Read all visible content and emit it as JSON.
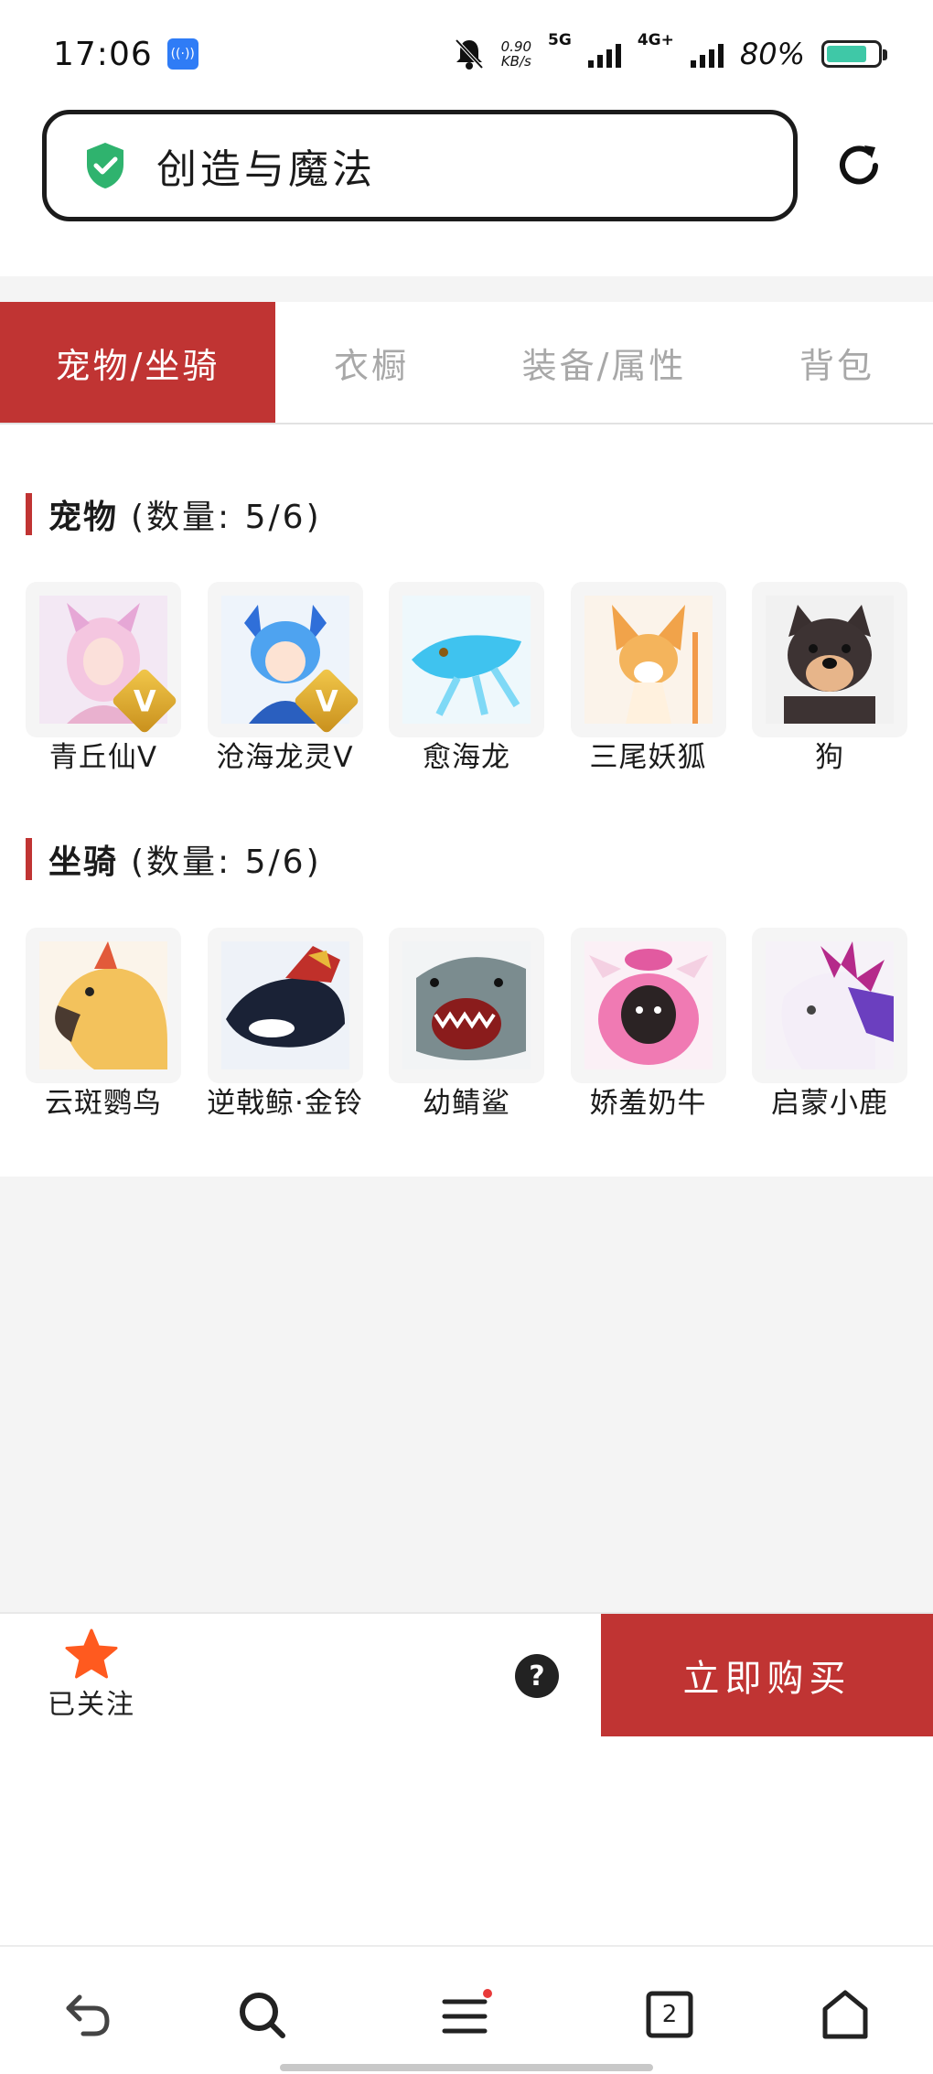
{
  "status_bar": {
    "time": "17:06",
    "speed_value": "0.90",
    "speed_unit": "KB/s",
    "net1": "5G",
    "net2": "4G+",
    "battery": "80%"
  },
  "url_bar": {
    "title": "创造与魔法",
    "secure_icon": "shield-check-icon",
    "reload_icon": "reload-icon"
  },
  "tabs": [
    {
      "label": "宠物/坐骑",
      "active": true
    },
    {
      "label": "衣橱",
      "active": false
    },
    {
      "label": "装备/属性",
      "active": false
    },
    {
      "label": "背包",
      "active": false
    }
  ],
  "pets": {
    "title": "宠物",
    "count": "(数量: 5/6)",
    "items": [
      {
        "name": "青丘仙V",
        "badge": "V"
      },
      {
        "name": "沧海龙灵V",
        "badge": "V"
      },
      {
        "name": "愈海龙",
        "badge": ""
      },
      {
        "name": "三尾妖狐",
        "badge": ""
      },
      {
        "name": "狗",
        "badge": ""
      }
    ]
  },
  "mounts": {
    "title": "坐骑",
    "count": "(数量: 5/6)",
    "items": [
      {
        "name": "云斑鹦鸟"
      },
      {
        "name": "逆戟鲸·金铃"
      },
      {
        "name": "幼鲭鲨"
      },
      {
        "name": "娇羞奶牛"
      },
      {
        "name": "启蒙小鹿"
      }
    ]
  },
  "action_bar": {
    "follow_label": "已关注",
    "help_label": "?",
    "buy_label": "立即购买"
  },
  "nav": {
    "tabs_count": "2"
  },
  "colors": {
    "accent": "#c03433",
    "star": "#ff5a1f",
    "secure": "#2fb36e"
  }
}
